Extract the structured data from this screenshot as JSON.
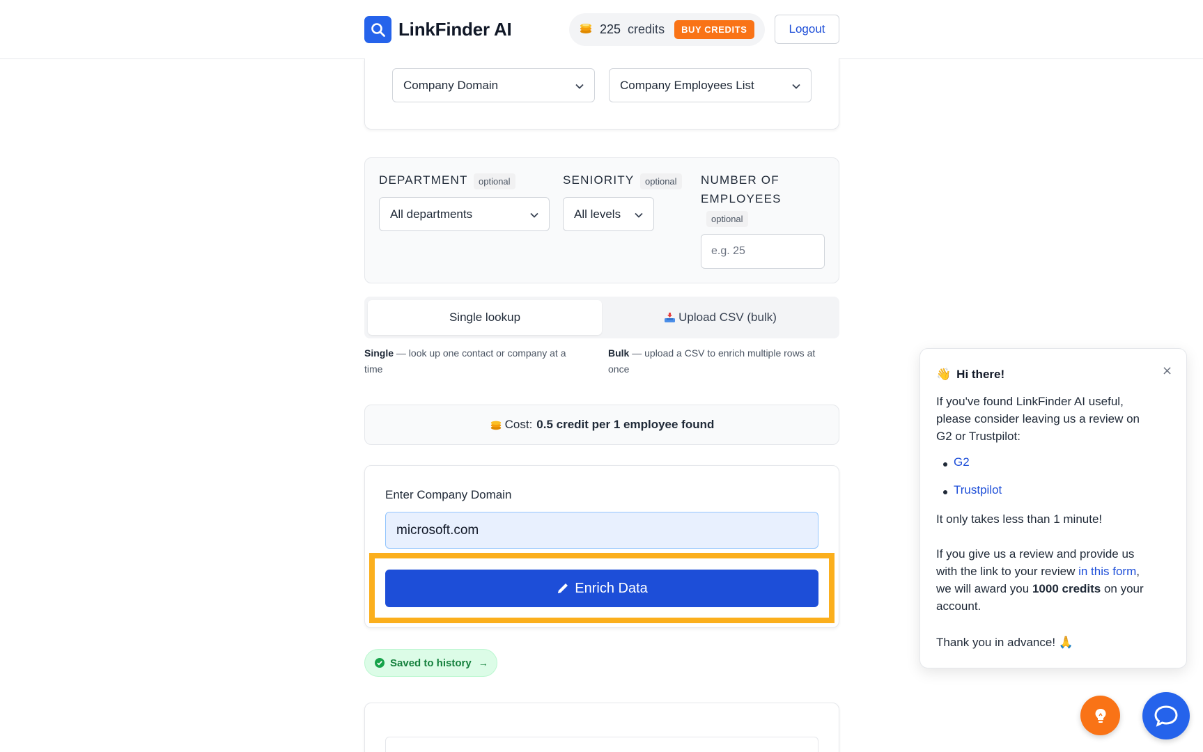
{
  "header": {
    "brand": "LinkFinder AI",
    "credits_count": "225",
    "credits_label": "credits",
    "buy_label": "BUY CREDITS",
    "logout_label": "Logout"
  },
  "top_selects": {
    "input_type": "Company Domain",
    "output_type": "Company Employees List"
  },
  "filters": {
    "department_label": "DEPARTMENT",
    "department_optional": "optional",
    "department_value": "All departments",
    "seniority_label": "SENIORITY",
    "seniority_optional": "optional",
    "seniority_value": "All levels",
    "employees_label_line1": "NUMBER OF",
    "employees_label_line2": "EMPLOYEES",
    "employees_optional": "optional",
    "employees_placeholder": "e.g. 25"
  },
  "mode_tabs": {
    "single_label": "Single lookup",
    "bulk_label": "Upload CSV (bulk)",
    "single_desc_bold": "Single",
    "single_desc_line1": " — look up one contact or company at a",
    "single_desc_line2": "time",
    "bulk_desc_bold": "Bulk",
    "bulk_desc_line1": " — upload a CSV to enrich multiple rows at",
    "bulk_desc_line2": "once"
  },
  "cost": {
    "prefix": "Cost:",
    "value": "0.5 credit per 1 employee found"
  },
  "form": {
    "label": "Enter Company Domain",
    "domain_value": "microsoft.com",
    "enrich_label": "Enrich Data"
  },
  "saved": {
    "label": "Saved to history",
    "arrow": "→"
  },
  "popup": {
    "title": "Hi there!",
    "close": "×",
    "intro_1": "If you've found LinkFinder AI useful,",
    "intro_2": "please consider leaving us a review on",
    "intro_3": "G2 or Trustpilot:",
    "link_g2": "G2",
    "link_trustpilot": "Trustpilot",
    "minute": "It only takes less than 1 minute!",
    "offer_1": "If you give us a review and provide us",
    "offer_2_pre": "with the link to your review ",
    "offer_2_link": "in this form",
    "offer_2_post": ",",
    "offer_3_pre": "we will award you ",
    "offer_3_bold": "1000 credits",
    "offer_3_post": " on your",
    "offer_4": "account.",
    "thanks": "Thank you in advance! 🙏"
  },
  "colors": {
    "brand_blue": "#2563eb",
    "button_blue": "#1d4ed8",
    "buy_orange": "#f97316",
    "highlight": "#fbaf1d",
    "success_green": "#15803d"
  },
  "icons": [
    "search-icon",
    "coins-icon",
    "chevron-down-icon",
    "inbox-tray-icon",
    "pencil-icon",
    "check-circle-icon",
    "wave-icon",
    "close-icon",
    "lightbulb-icon",
    "chat-bubble-icon"
  ]
}
